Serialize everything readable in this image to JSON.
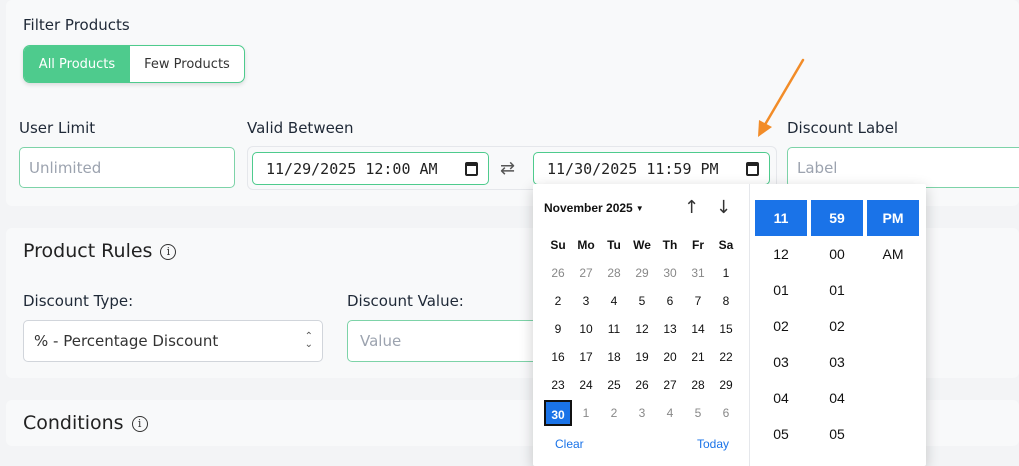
{
  "filter": {
    "title": "Filter Products",
    "options": [
      "All Products",
      "Few Products"
    ]
  },
  "user_limit": {
    "label": "User Limit",
    "placeholder": "Unlimited"
  },
  "valid_between": {
    "label": "Valid Between",
    "start": "11/29/2025 12:00 AM",
    "end": "11/30/2025 11:59 PM"
  },
  "discount_label": {
    "label": "Discount Label",
    "placeholder": "Label"
  },
  "product_rules": {
    "title": "Product Rules",
    "info": "i",
    "discount_type_label": "Discount Type:",
    "discount_type_value": "% - Percentage Discount",
    "discount_value_label": "Discount Value:",
    "discount_value_placeholder": "Value"
  },
  "conditions": {
    "title": "Conditions",
    "info": "i"
  },
  "picker": {
    "month": "November 2025",
    "weekdays": [
      "Su",
      "Mo",
      "Tu",
      "We",
      "Th",
      "Fr",
      "Sa"
    ],
    "weeks": [
      [
        "26",
        "27",
        "28",
        "29",
        "30",
        "31",
        "1"
      ],
      [
        "2",
        "3",
        "4",
        "5",
        "6",
        "7",
        "8"
      ],
      [
        "9",
        "10",
        "11",
        "12",
        "13",
        "14",
        "15"
      ],
      [
        "16",
        "17",
        "18",
        "19",
        "20",
        "21",
        "22"
      ],
      [
        "23",
        "24",
        "25",
        "26",
        "27",
        "28",
        "29"
      ],
      [
        "30",
        "1",
        "2",
        "3",
        "4",
        "5",
        "6"
      ]
    ],
    "clear": "Clear",
    "today": "Today",
    "hours": [
      "11",
      "12",
      "01",
      "02",
      "03",
      "04",
      "05"
    ],
    "minutes": [
      "59",
      "00",
      "01",
      "02",
      "03",
      "04",
      "05"
    ],
    "ampm": [
      "PM",
      "AM"
    ]
  },
  "colors": {
    "accent_green": "#4ecb8d",
    "accent_blue": "#1a73e8",
    "arrow_orange": "#f28c28"
  }
}
